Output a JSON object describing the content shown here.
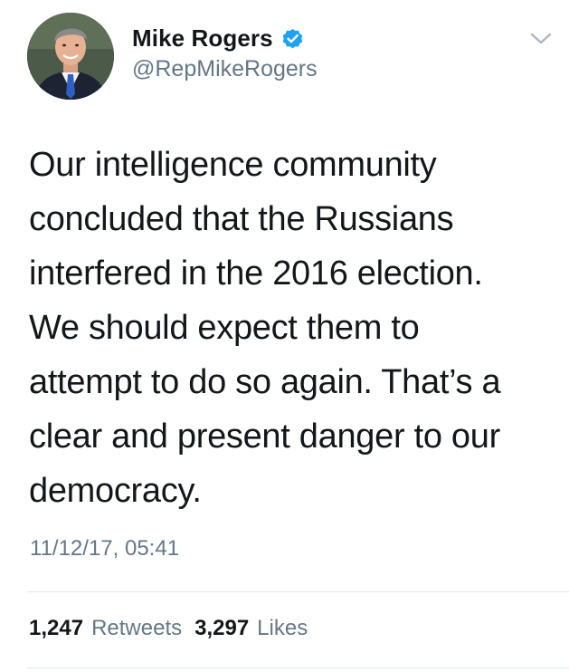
{
  "author": {
    "display_name": "Mike Rogers",
    "handle": "@RepMikeRogers",
    "verified": true,
    "avatar_icon": "profile-photo"
  },
  "menu": {
    "icon": "chevron-down-icon"
  },
  "tweet": {
    "text": "Our intelligence community\nconcluded that the Russians\ninterfered in the 2016 election.\nWe should expect them to\nattempt to do so again. That’s a\nclear and present danger to our\ndemocracy.",
    "timestamp": "11/12/17, 05:41"
  },
  "stats": {
    "retweets_count": "1,247",
    "retweets_label": "Retweets",
    "likes_count": "3,297",
    "likes_label": "Likes"
  },
  "colors": {
    "text": "#14171a",
    "secondary": "#657786",
    "verified_blue": "#1da1f2",
    "divider": "#e1e8ed"
  }
}
